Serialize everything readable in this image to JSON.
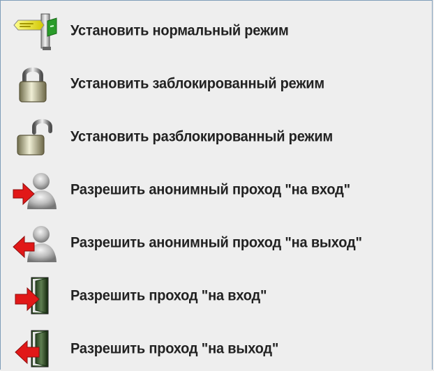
{
  "items": [
    {
      "label": "Установить нормальный режим",
      "icon": "normal-mode-icon"
    },
    {
      "label": "Установить заблокированный режим",
      "icon": "locked-mode-icon"
    },
    {
      "label": "Установить разблокированный режим",
      "icon": "unlocked-mode-icon"
    },
    {
      "label": "Разрешить анонимный проход \"на вход\"",
      "icon": "anonymous-entry-icon"
    },
    {
      "label": "Разрешить анонимный проход \"на выход\"",
      "icon": "anonymous-exit-icon"
    },
    {
      "label": "Разрешить проход \"на вход\"",
      "icon": "entry-door-icon"
    },
    {
      "label": "Разрешить проход \"на выход\"",
      "icon": "exit-door-icon"
    }
  ]
}
